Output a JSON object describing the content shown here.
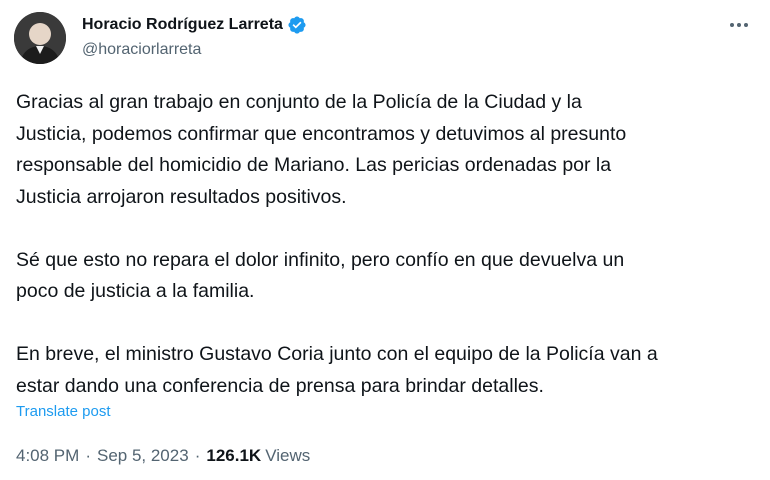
{
  "author": {
    "display_name": "Horacio Rodríguez Larreta",
    "handle": "@horaciorlarreta",
    "verified": true,
    "avatar_icon": "avatar-photo-icon"
  },
  "menu": {
    "icon": "more-icon"
  },
  "tweet": {
    "text": "Gracias al gran trabajo en conjunto de la Policía de la Ciudad y la\nJusticia, podemos confirmar que encontramos y detuvimos al presunto\nresponsable del homicidio de Mariano. Las pericias ordenadas por la\nJusticia arrojaron resultados positivos.\n\nSé que esto no repara el dolor infinito, pero confío en que devuelva un\npoco de justicia a la familia.\n\nEn breve, el ministro Gustavo Coria junto con el equipo de la Policía van a\nestar dando una conferencia de prensa para brindar detalles.",
    "translate_label": "Translate post"
  },
  "meta": {
    "time": "4:08 PM",
    "separator": "·",
    "date": "Sep 5, 2023",
    "views_count": "126.1K",
    "views_label": "Views"
  },
  "colors": {
    "text": "#0f1419",
    "secondary": "#536471",
    "link": "#1d9bf0",
    "verified": "#1d9bf0"
  }
}
